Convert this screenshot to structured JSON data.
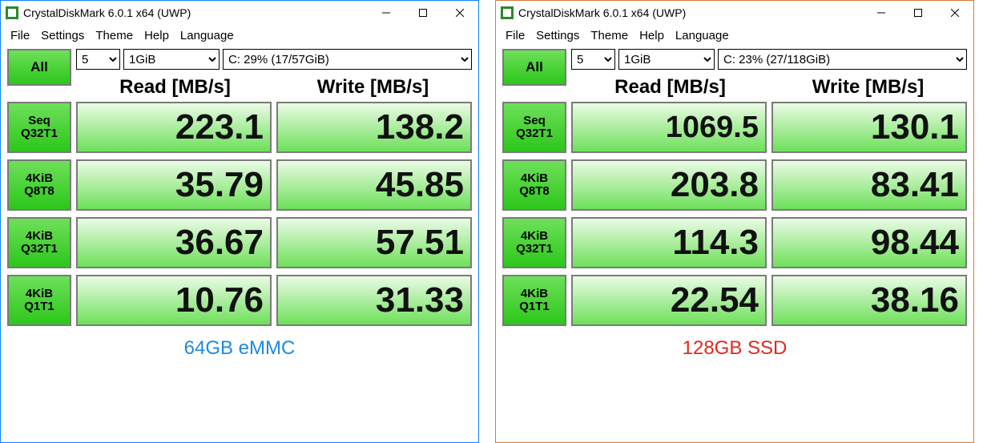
{
  "windows": [
    {
      "title": "CrystalDiskMark 6.0.1 x64 (UWP)",
      "menu": [
        "File",
        "Settings",
        "Theme",
        "Help",
        "Language"
      ],
      "all_label": "All",
      "runs": "5",
      "size": "1GiB",
      "drive": "C: 29% (17/57GiB)",
      "read_header": "Read [MB/s]",
      "write_header": "Write [MB/s]",
      "tests": [
        {
          "label": "Seq\nQ32T1",
          "read": "223.1",
          "write": "138.2"
        },
        {
          "label": "4KiB\nQ8T8",
          "read": "35.79",
          "write": "45.85"
        },
        {
          "label": "4KiB\nQ32T1",
          "read": "36.67",
          "write": "57.51"
        },
        {
          "label": "4KiB\nQ1T1",
          "read": "10.76",
          "write": "31.33"
        }
      ],
      "caption": "64GB eMMC",
      "caption_class": "blue"
    },
    {
      "title": "CrystalDiskMark 6.0.1 x64 (UWP)",
      "menu": [
        "File",
        "Settings",
        "Theme",
        "Help",
        "Language"
      ],
      "all_label": "All",
      "runs": "5",
      "size": "1GiB",
      "drive": "C: 23% (27/118GiB)",
      "read_header": "Read [MB/s]",
      "write_header": "Write [MB/s]",
      "tests": [
        {
          "label": "Seq\nQ32T1",
          "read": "1069.5",
          "write": "130.1"
        },
        {
          "label": "4KiB\nQ8T8",
          "read": "203.8",
          "write": "83.41"
        },
        {
          "label": "4KiB\nQ32T1",
          "read": "114.3",
          "write": "98.44"
        },
        {
          "label": "4KiB\nQ1T1",
          "read": "22.54",
          "write": "38.16"
        }
      ],
      "caption": "128GB SSD",
      "caption_class": "red"
    }
  ]
}
